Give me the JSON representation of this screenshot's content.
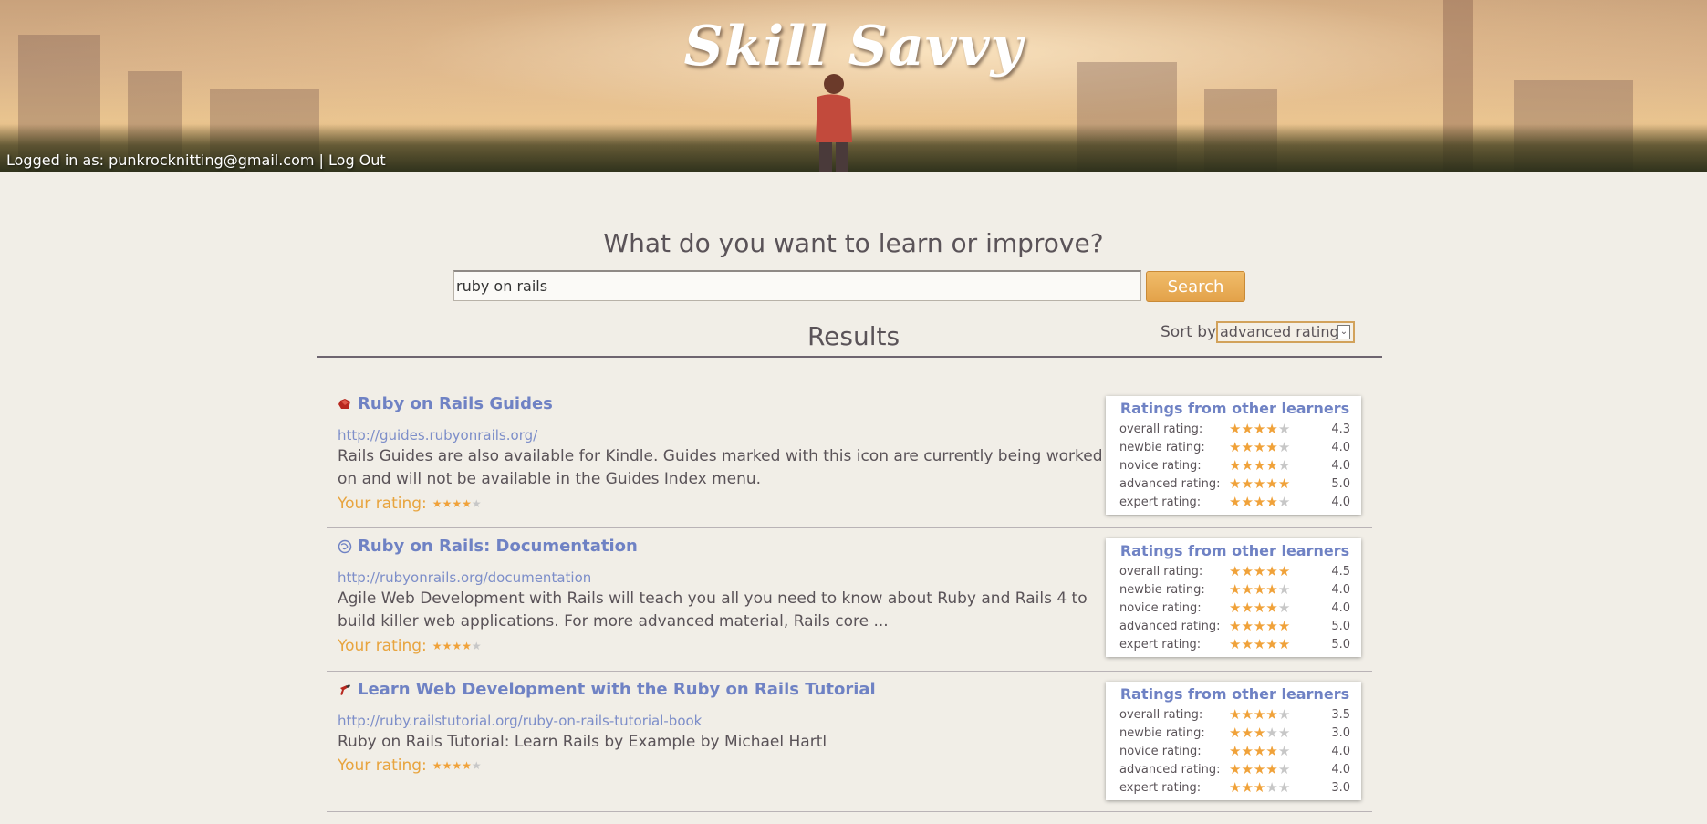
{
  "header": {
    "logo": "Skill Savvy",
    "login_prefix": "Logged in as: ",
    "user_email": "punkrocknitting@gmail.com",
    "separator": " | ",
    "logout_label": "Log Out"
  },
  "search": {
    "question": "What do you want to learn or improve?",
    "query": "ruby on rails",
    "button_label": "Search"
  },
  "results_header": {
    "title": "Results",
    "sort_label": "Sort by",
    "sort_value": "advanced rating"
  },
  "ratings_box_title": "Ratings from other learners",
  "your_rating_label": "Your rating:",
  "colors": {
    "accent": "#e8a43e",
    "link": "#6f82c4",
    "text": "#5a5358"
  },
  "results": [
    {
      "favicon": "ruby-gem-icon",
      "title": "Ruby on Rails Guides",
      "url": "http://guides.rubyonrails.org/",
      "description": "Rails Guides are also available for Kindle. Guides marked with this icon are currently being worked on and will not be available in the Guides Index menu.",
      "your_rating": 4,
      "ratings": [
        {
          "label": "overall rating:",
          "value": "4.3"
        },
        {
          "label": "newbie rating:",
          "value": "4.0"
        },
        {
          "label": "novice rating:",
          "value": "4.0"
        },
        {
          "label": "advanced rating:",
          "value": "5.0"
        },
        {
          "label": "expert rating:",
          "value": "4.0"
        }
      ]
    },
    {
      "favicon": "globe-icon",
      "title": "Ruby on Rails: Documentation",
      "url": "http://rubyonrails.org/documentation",
      "description": "Agile Web Development with Rails will teach you all you need to know about Ruby and Rails 4 to build killer web applications. For more advanced material, Rails core ...",
      "your_rating": 4,
      "ratings": [
        {
          "label": "overall rating:",
          "value": "4.5"
        },
        {
          "label": "newbie rating:",
          "value": "4.0"
        },
        {
          "label": "novice rating:",
          "value": "4.0"
        },
        {
          "label": "advanced rating:",
          "value": "5.0"
        },
        {
          "label": "expert rating:",
          "value": "5.0"
        }
      ]
    },
    {
      "favicon": "rails-tutorial-icon",
      "title": "Learn Web Development with the Ruby on Rails Tutorial",
      "url": "http://ruby.railstutorial.org/ruby-on-rails-tutorial-book",
      "description": "Ruby on Rails Tutorial: Learn Rails by Example by Michael Hartl",
      "your_rating": 4,
      "ratings": [
        {
          "label": "overall rating:",
          "value": "3.5"
        },
        {
          "label": "newbie rating:",
          "value": "3.0"
        },
        {
          "label": "novice rating:",
          "value": "4.0"
        },
        {
          "label": "advanced rating:",
          "value": "4.0"
        },
        {
          "label": "expert rating:",
          "value": "3.0"
        }
      ]
    }
  ]
}
